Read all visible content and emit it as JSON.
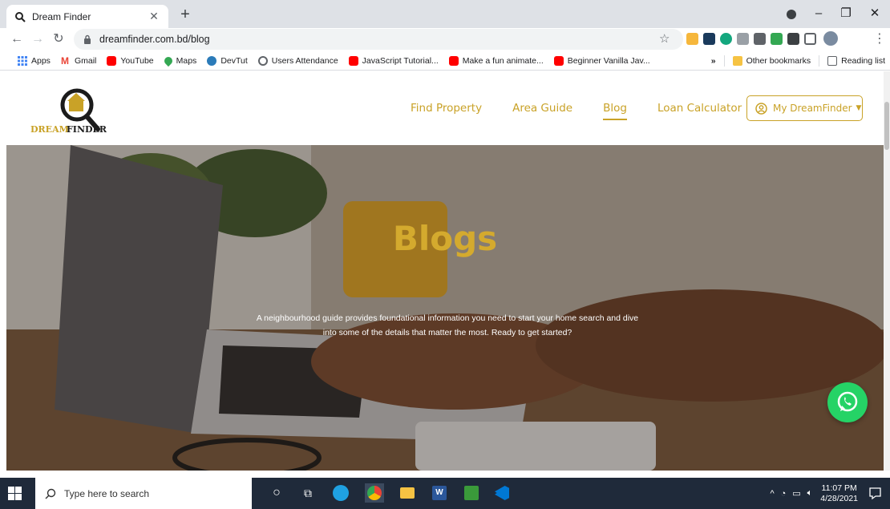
{
  "browser": {
    "tab_title": "Dream Finder",
    "url": "dreamfinder.com.bd/blog",
    "bookmarks": [
      "Apps",
      "Gmail",
      "YouTube",
      "Maps",
      "DevTut",
      "Users Attendance",
      "JavaScript Tutorial...",
      "Make a fun animate...",
      "Beginner Vanilla Jav..."
    ],
    "other_bookmarks": "Other bookmarks",
    "reading_list": "Reading list"
  },
  "site": {
    "logo_text": "DreamFinder",
    "nav": [
      "Find Property",
      "Area Guide",
      "Blog",
      "Loan Calculator"
    ],
    "active_nav": "Blog",
    "account_label": "My DreamFinder"
  },
  "hero": {
    "title": "Blogs",
    "description": "A neighbourhood guide provides foundational information you need to start your home search and dive into some of the details that matter the most. Ready to get started?"
  },
  "taskbar": {
    "search_placeholder": "Type here to search",
    "time": "11:07 PM",
    "date": "4/28/2021"
  },
  "colors": {
    "brand_gold": "#c9a227",
    "whatsapp_green": "#25d366",
    "taskbar": "#1f2a3a"
  }
}
